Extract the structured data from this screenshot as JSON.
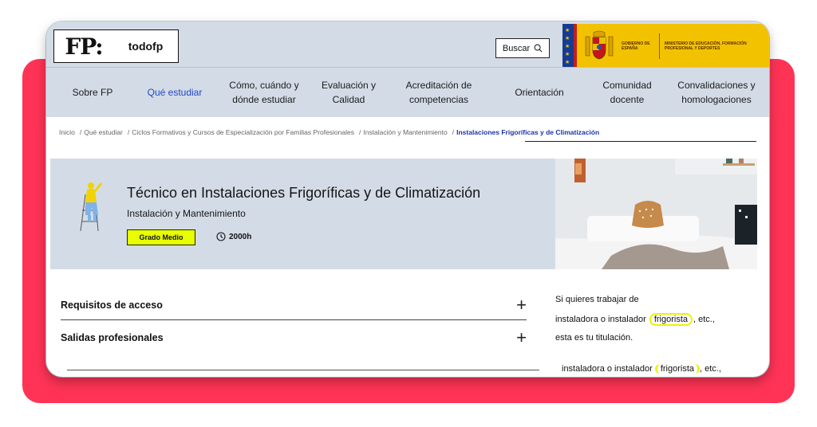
{
  "header": {
    "logo": "FP:",
    "site_name": "todofp",
    "search_label": "Buscar",
    "gov_line1": "GOBIERNO DE ESPAÑA",
    "gov_line2": "MINISTERIO DE EDUCACIÓN, FORMACIÓN PROFESIONAL Y DEPORTES"
  },
  "nav": {
    "items": [
      {
        "label": "Sobre FP"
      },
      {
        "label": "Qué estudiar"
      },
      {
        "label": "Cómo, cuándo y dónde estudiar"
      },
      {
        "label": "Evaluación y Calidad"
      },
      {
        "label": "Acreditación de competencias"
      },
      {
        "label": "Orientación"
      },
      {
        "label": "Comunidad docente"
      },
      {
        "label": "Convalidaciones y homologaciones"
      }
    ],
    "active_color": "#2148c9"
  },
  "breadcrumb": {
    "items": [
      "Inicio",
      "Qué estudiar",
      "Ciclos Formativos y Cursos de Especialización por Familias Profesionales",
      "Instalación y Mantenimiento",
      "Instalaciones Frigoríficas y de Climatización"
    ],
    "separator": "/"
  },
  "hero": {
    "title": "Técnico en Instalaciones Frigoríficas y de Climatización",
    "family": "Instalación y Mantenimiento",
    "level": "Grado Medio",
    "duration": "2000h",
    "badge_color": "#e8ff00"
  },
  "accordion": {
    "items": [
      {
        "label": "Requisitos de acceso",
        "icon": "plus-icon"
      },
      {
        "label": "Salidas profesionales",
        "icon": "plus-icon"
      }
    ]
  },
  "sidebar": {
    "line1": "Si quieres trabajar de",
    "line2_pre": "instaladora o instalador",
    "line2_hl": "frigorista",
    "line2_post": ", etc.,",
    "line3": "esta es tu titulación.",
    "line4_pre": "instaladora o instalador",
    "line4_hl": "frigorista",
    "line4_post": ", etc.,"
  },
  "colors": {
    "accent_red": "#ff3355",
    "header_bg": "#d3dce6",
    "highlight": "#eef200"
  }
}
